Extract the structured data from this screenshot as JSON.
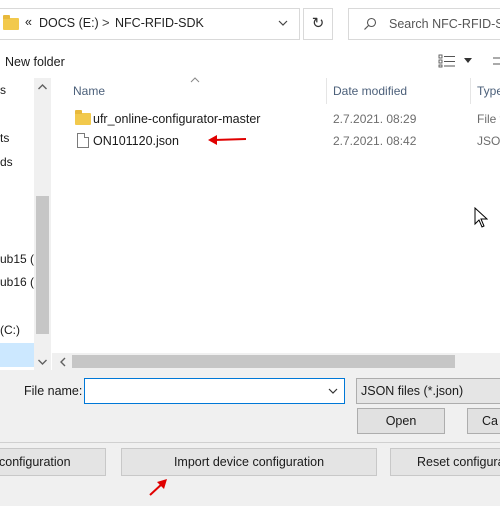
{
  "address_bar": {
    "overflow": "«",
    "crumbs": [
      "DOCS (E:)",
      "NFC-RFID-SDK"
    ],
    "separator": ">"
  },
  "search": {
    "placeholder": "Search NFC-RFID-SDK"
  },
  "toolbar": {
    "new_folder": "New folder"
  },
  "nav_pane": {
    "items": [
      "s",
      "ts",
      "ds",
      "ub15 (",
      "ub16 (",
      "(C:)"
    ]
  },
  "columns": {
    "name": "Name",
    "date_modified": "Date modified",
    "type": "Type"
  },
  "files": [
    {
      "name": "ufr_online-configurator-master",
      "date": "2.7.2021. 08:29",
      "type": "File f",
      "kind": "folder"
    },
    {
      "name": "ON101120.json",
      "date": "2.7.2021. 08:42",
      "type": "JSON",
      "kind": "file"
    }
  ],
  "file_name": {
    "label": "File name:",
    "value": ""
  },
  "file_type": {
    "selected": "JSON files (*.json)"
  },
  "buttons": {
    "open": "Open",
    "cancel": "Ca"
  },
  "app_buttons": {
    "export": "configuration",
    "import": "Import device configuration",
    "reset": "Reset configurati"
  },
  "colors": {
    "accent": "#0078d7",
    "selection": "#cce8ff",
    "annotation": "#e00000",
    "folder": "#f2c94c"
  }
}
